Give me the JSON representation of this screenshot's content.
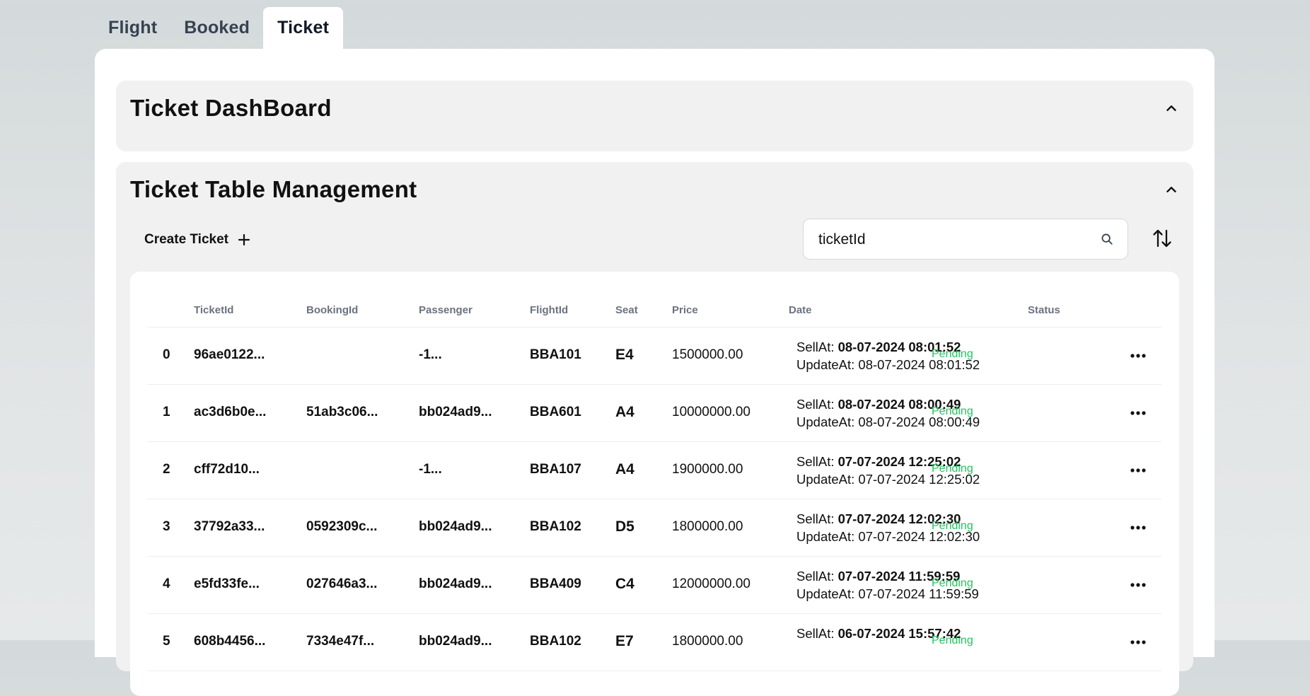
{
  "tabs": [
    {
      "label": "Flight"
    },
    {
      "label": "Booked"
    },
    {
      "label": "Ticket"
    }
  ],
  "dashboard": {
    "title": "Ticket DashBoard"
  },
  "management": {
    "title": "Ticket Table Management",
    "create_label": "Create Ticket",
    "search_value": "ticketId"
  },
  "table": {
    "headers": [
      "TicketId",
      "BookingId",
      "Passenger",
      "FlightId",
      "Seat",
      "Price",
      "Date",
      "Status"
    ],
    "rows": [
      {
        "idx": "0",
        "ticket": "96ae0122...",
        "booking": "",
        "passenger": "-1...",
        "flight": "BBA101",
        "seat": "E4",
        "price": "1500000.00",
        "sell_prefix": "SellAt: ",
        "sell": "08-07-2024 08:01:52",
        "update": "UpdateAt: 08-07-2024 08:01:52",
        "status": "Pending"
      },
      {
        "idx": "1",
        "ticket": "ac3d6b0e...",
        "booking": "51ab3c06...",
        "passenger": "bb024ad9...",
        "flight": "BBA601",
        "seat": "A4",
        "price": "10000000.00",
        "sell_prefix": "SellAt: ",
        "sell": "08-07-2024 08:00:49",
        "update": "UpdateAt: 08-07-2024 08:00:49",
        "status": "Pending"
      },
      {
        "idx": "2",
        "ticket": "cff72d10...",
        "booking": "",
        "passenger": "-1...",
        "flight": "BBA107",
        "seat": "A4",
        "price": "1900000.00",
        "sell_prefix": "SellAt: ",
        "sell": "07-07-2024 12:25:02",
        "update": "UpdateAt: 07-07-2024 12:25:02",
        "status": "Pending"
      },
      {
        "idx": "3",
        "ticket": "37792a33...",
        "booking": "0592309c...",
        "passenger": "bb024ad9...",
        "flight": "BBA102",
        "seat": "D5",
        "price": "1800000.00",
        "sell_prefix": "SellAt: ",
        "sell": "07-07-2024 12:02:30",
        "update": "UpdateAt: 07-07-2024 12:02:30",
        "status": "Pending"
      },
      {
        "idx": "4",
        "ticket": "e5fd33fe...",
        "booking": "027646a3...",
        "passenger": "bb024ad9...",
        "flight": "BBA409",
        "seat": "C4",
        "price": "12000000.00",
        "sell_prefix": "SellAt: ",
        "sell": "07-07-2024 11:59:59",
        "update": "UpdateAt: 07-07-2024 11:59:59",
        "status": "Pending"
      },
      {
        "idx": "5",
        "ticket": "608b4456...",
        "booking": "7334e47f...",
        "passenger": "bb024ad9...",
        "flight": "BBA102",
        "seat": "E7",
        "price": "1800000.00",
        "sell_prefix": "SellAt: ",
        "sell": "06-07-2024 15:57:42",
        "update": "",
        "status": "Pending"
      }
    ]
  },
  "colors": {
    "status_pending": "#22c55e",
    "accent": "#111827"
  }
}
